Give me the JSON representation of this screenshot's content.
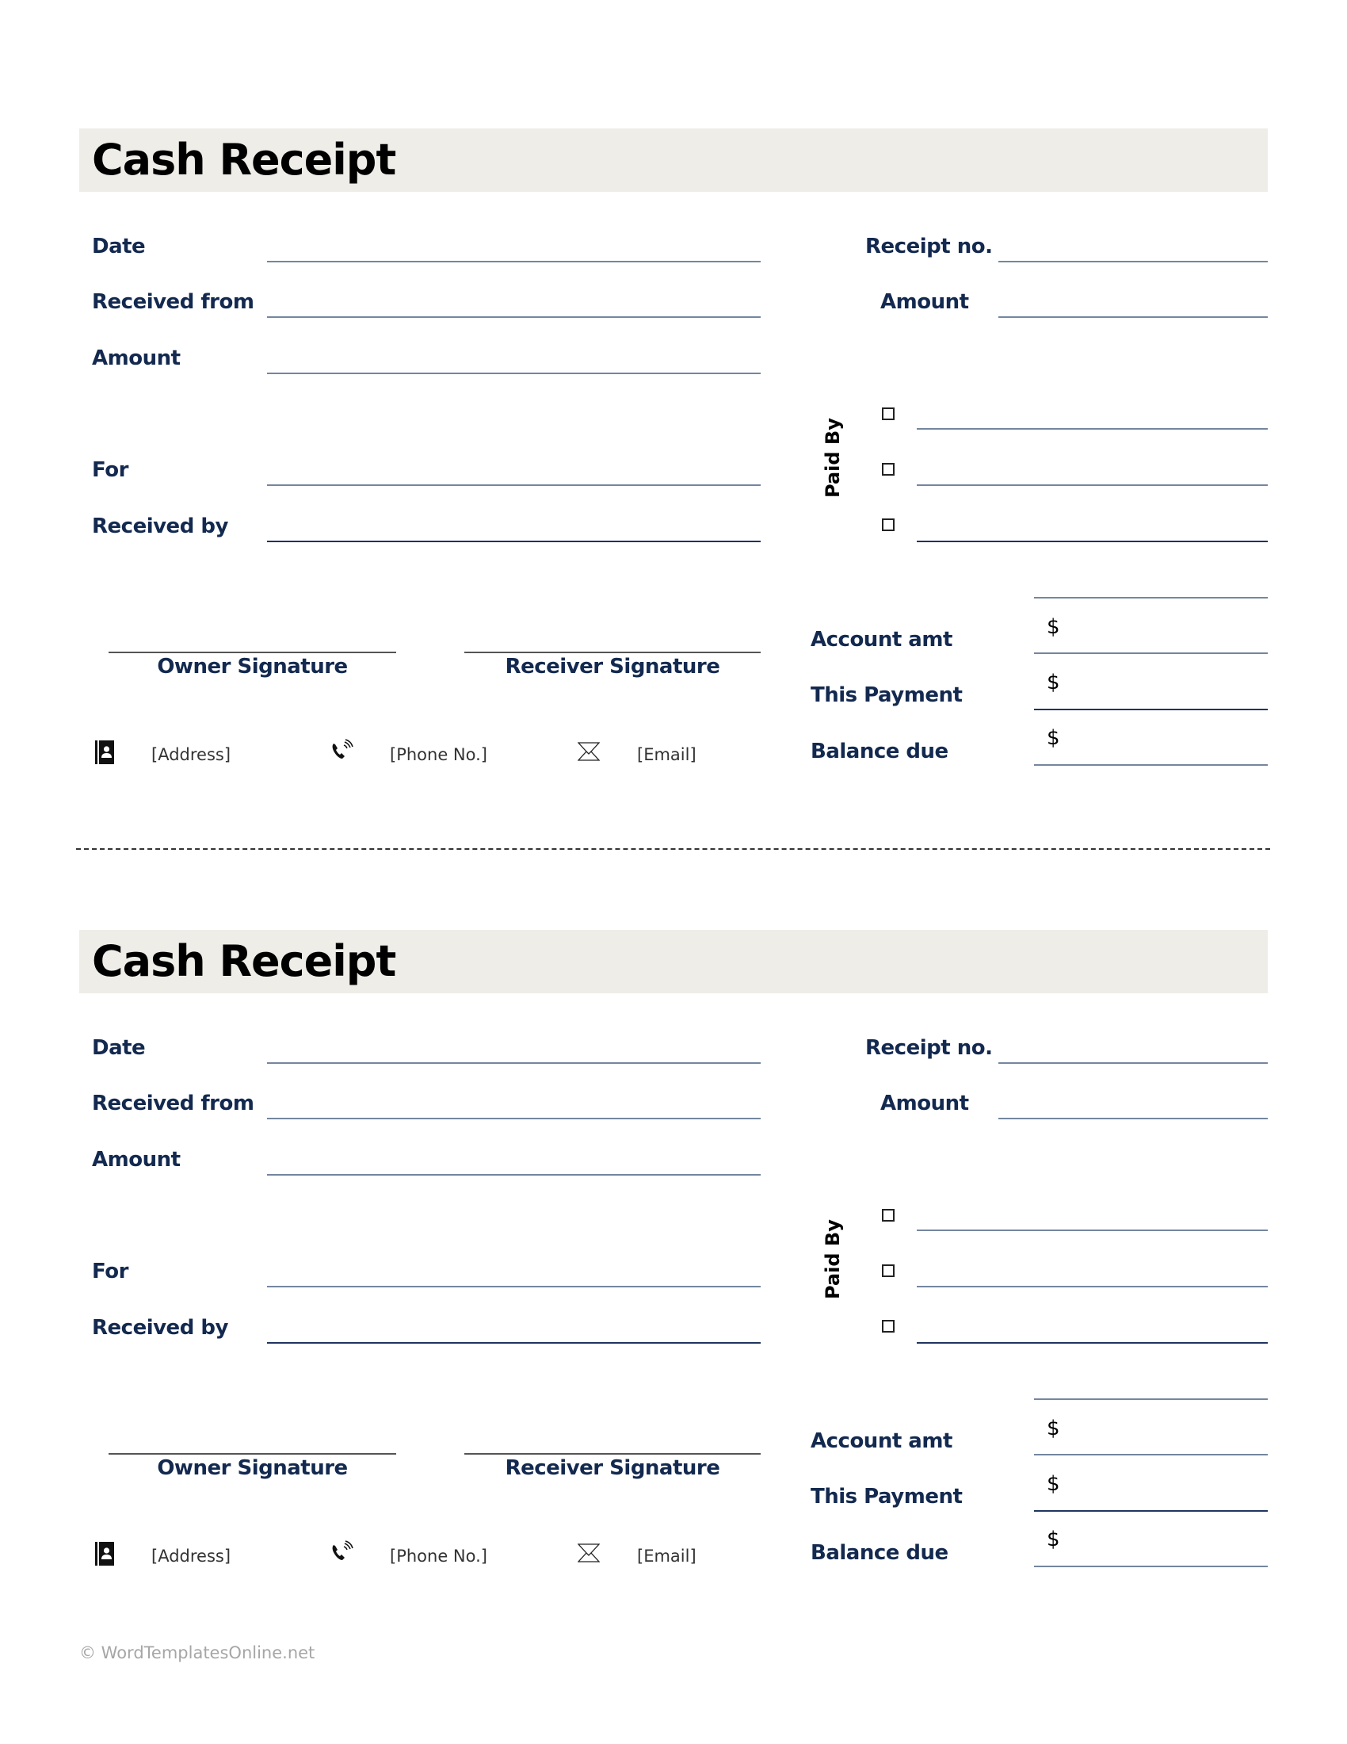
{
  "receipts": [
    {
      "title": "Cash Receipt",
      "fields": {
        "date": {
          "label": "Date",
          "value": ""
        },
        "received_from": {
          "label": "Received from",
          "value": ""
        },
        "amount": {
          "label": "Amount",
          "value": ""
        },
        "for": {
          "label": "For",
          "value": ""
        },
        "received_by": {
          "label": "Received by",
          "value": ""
        },
        "receipt_no": {
          "label": "Receipt no.",
          "value": ""
        },
        "amount_right": {
          "label": "Amount",
          "value": ""
        }
      },
      "paid_by": {
        "label": "Paid By",
        "options": [
          {
            "checked": false,
            "value": ""
          },
          {
            "checked": false,
            "value": ""
          },
          {
            "checked": false,
            "value": ""
          }
        ]
      },
      "totals": {
        "currency_symbol": "$",
        "account_amt": {
          "label": "Account amt",
          "value": ""
        },
        "this_payment": {
          "label": "This Payment",
          "value": ""
        },
        "balance_due": {
          "label": "Balance due",
          "value": ""
        }
      },
      "signatures": {
        "owner": "Owner Signature",
        "receiver": "Receiver Signature"
      },
      "contact": {
        "address": {
          "icon": "address-book-icon",
          "text": "[Address]"
        },
        "phone": {
          "icon": "phone-icon",
          "text": "[Phone No.]"
        },
        "email": {
          "icon": "envelope-icon",
          "text": "[Email]"
        }
      }
    },
    {
      "title": "Cash Receipt",
      "fields": {
        "date": {
          "label": "Date",
          "value": ""
        },
        "received_from": {
          "label": "Received from",
          "value": ""
        },
        "amount": {
          "label": "Amount",
          "value": ""
        },
        "for": {
          "label": "For",
          "value": ""
        },
        "received_by": {
          "label": "Received by",
          "value": ""
        },
        "receipt_no": {
          "label": "Receipt no.",
          "value": ""
        },
        "amount_right": {
          "label": "Amount",
          "value": ""
        }
      },
      "paid_by": {
        "label": "Paid By",
        "options": [
          {
            "checked": false,
            "value": ""
          },
          {
            "checked": false,
            "value": ""
          },
          {
            "checked": false,
            "value": ""
          }
        ]
      },
      "totals": {
        "currency_symbol": "$",
        "account_amt": {
          "label": "Account amt",
          "value": ""
        },
        "this_payment": {
          "label": "This Payment",
          "value": ""
        },
        "balance_due": {
          "label": "Balance due",
          "value": ""
        }
      },
      "signatures": {
        "owner": "Owner Signature",
        "receiver": "Receiver Signature"
      },
      "contact": {
        "address": {
          "icon": "address-book-icon",
          "text": "[Address]"
        },
        "phone": {
          "icon": "phone-icon",
          "text": "[Phone No.]"
        },
        "email": {
          "icon": "envelope-icon",
          "text": "[Email]"
        }
      }
    }
  ],
  "footer": {
    "copyright": "© WordTemplatesOnline.net"
  }
}
